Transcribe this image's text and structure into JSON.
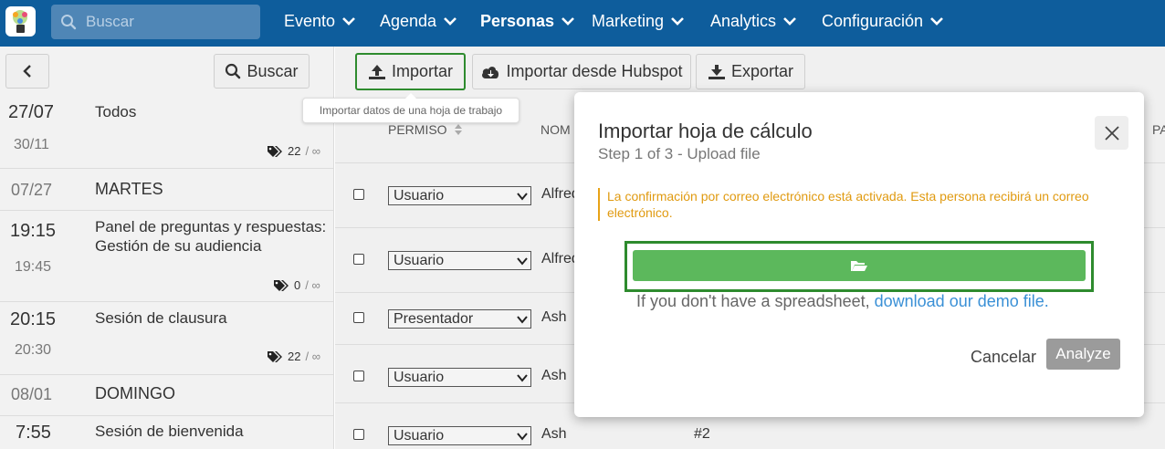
{
  "nav": {
    "search_placeholder": "Buscar",
    "menu": [
      {
        "label": "Evento"
      },
      {
        "label": "Agenda"
      },
      {
        "label": "Personas"
      },
      {
        "label": "Marketing"
      },
      {
        "label": "Analytics"
      },
      {
        "label": "Configuración"
      }
    ]
  },
  "left_panel": {
    "search_label": "Buscar",
    "rows": [
      {
        "date": "27/07",
        "date2": "30/11",
        "title": "Todos",
        "tag_count": "22",
        "tag_max": "/ ∞"
      },
      {
        "date": "07/27",
        "day": "MARTES"
      },
      {
        "time": "19:15",
        "time_end": "19:45",
        "title_line1": "Panel de preguntas y respuestas:",
        "title_line2": "Gestión de su audiencia",
        "tag_count": "0",
        "tag_max": "/ ∞"
      },
      {
        "time": "20:15",
        "time_end": "20:30",
        "title": "Sesión de clausura",
        "tag_count": "22",
        "tag_max": "/ ∞"
      },
      {
        "date": "08/01",
        "day": "DOMINGO"
      },
      {
        "time": "7:55",
        "title": "Sesión de bienvenida"
      }
    ]
  },
  "toolbar": {
    "import_label": "Importar",
    "import_hubspot_label": "Importar desde Hubspot",
    "export_label": "Exportar",
    "tooltip": "Importar datos de una hoja de trabajo"
  },
  "table": {
    "headers": {
      "permiso": "PERMISO",
      "nombre": "NOM",
      "pa": "PA"
    },
    "rows": [
      {
        "role": "Usuario",
        "name": "Alfred"
      },
      {
        "role": "Usuario",
        "name": "Alfred"
      },
      {
        "role": "Presentador",
        "name": "Ash"
      },
      {
        "role": "Usuario",
        "name": "Ash"
      },
      {
        "role": "Usuario",
        "name": "Ash",
        "extra": "#2"
      }
    ]
  },
  "modal": {
    "title": "Importar hoja de cálculo",
    "subtitle": "Step 1 of 3 - Upload file",
    "warning": "La confirmación por correo electrónico está activada. Esta persona recibirá un correo electrónico.",
    "demo_prefix": "If you don't have a spreadsheet, ",
    "demo_link": "download our demo file.",
    "cancel_label": "Cancelar",
    "analyze_label": "Analyze"
  },
  "colors": {
    "nav_bg": "#0e5d9c",
    "upload_green": "#5cb85c",
    "highlight_border": "#2e8b2e",
    "warning": "#e09a10",
    "link": "#3a90d6"
  }
}
